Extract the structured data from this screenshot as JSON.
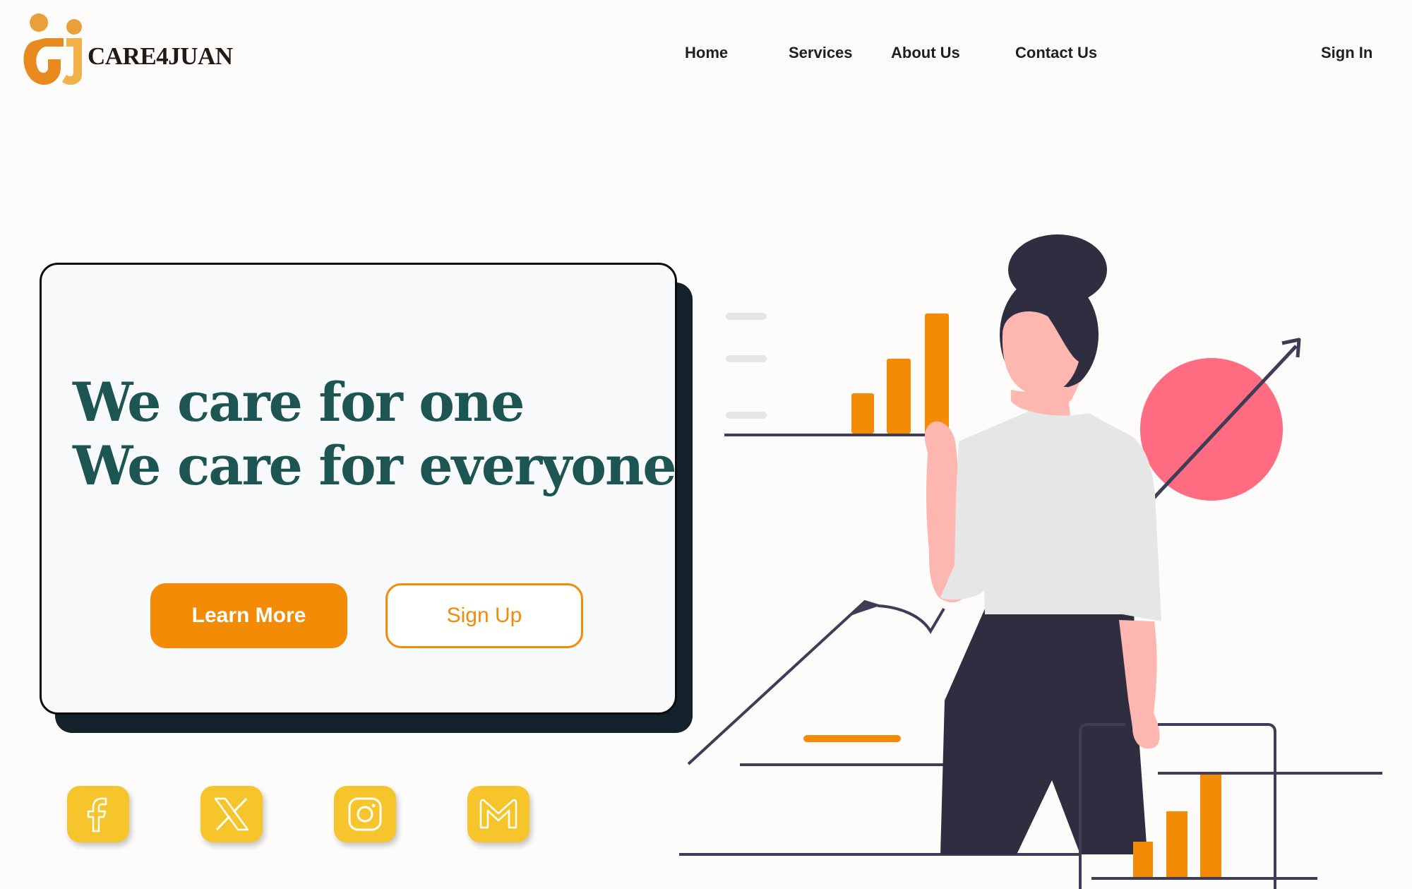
{
  "brand": {
    "name": "CARE4JUAN"
  },
  "nav": {
    "home": "Home",
    "services": "Services",
    "about": "About Us",
    "contact": "Contact Us",
    "sign_in": "Sign In"
  },
  "hero": {
    "line1": "We care for one",
    "line2": "We care for everyone",
    "learn_more": "Learn More",
    "sign_up": "Sign Up"
  },
  "socials": [
    "facebook-icon",
    "x-icon",
    "instagram-icon",
    "gmail-icon"
  ],
  "colors": {
    "accent": "#f38b07",
    "headline": "#1d5552",
    "social_bg": "#f6c52b",
    "card_shadow": "#12212a",
    "pink_circle": "#ff6b81",
    "dark_figure": "#2f2e41"
  }
}
